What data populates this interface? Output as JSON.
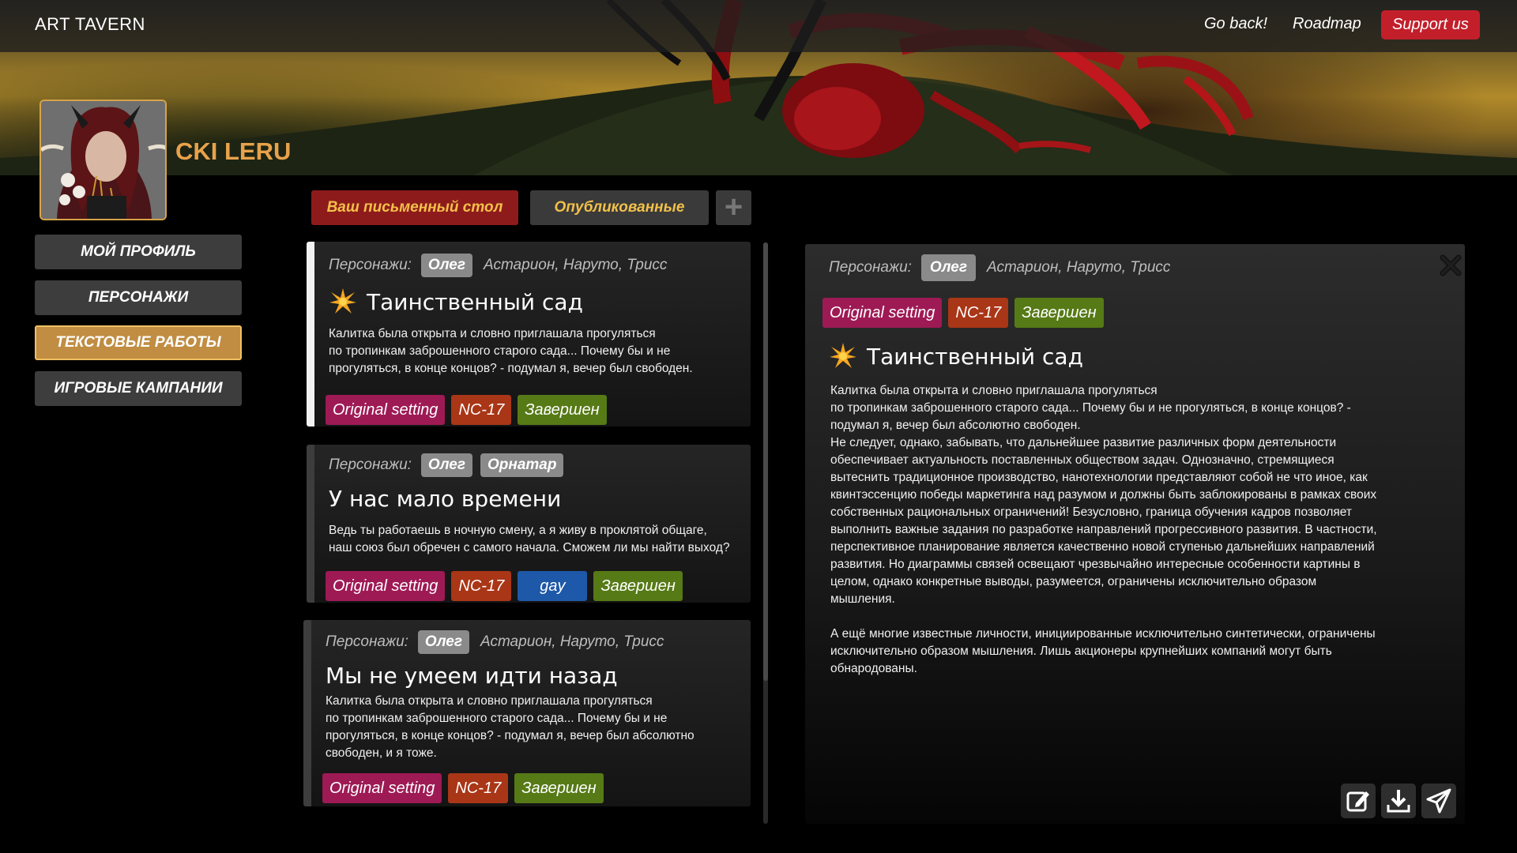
{
  "header": {
    "logo": "ART TAVERN",
    "nav": {
      "go_back": "Go back!",
      "roadmap": "Roadmap",
      "support": "Support us"
    }
  },
  "profile": {
    "username": "CKI LERU"
  },
  "sidebar": {
    "items": [
      {
        "label": "МОЙ ПРОФИЛЬ",
        "active": false
      },
      {
        "label": "ПЕРСОНАЖИ",
        "active": false
      },
      {
        "label": "ТЕКСТОВЫЕ РАБОТЫ",
        "active": true
      },
      {
        "label": "ИГРОВЫЕ КАМПАНИИ",
        "active": false
      }
    ]
  },
  "tabs": {
    "desk": "Ваш письменный стол",
    "published": "Опубликованные",
    "add": "+"
  },
  "stories": [
    {
      "chars_label": "Персонажи:",
      "main_chars": [
        "Олег"
      ],
      "other_chars": "Астарион, Наруто, Трисс",
      "title": "Таинственный сад",
      "starred": true,
      "text": "Калитка была открыта и словно приглашала прогуляться\nпо тропинкам заброшенного старого сада... Почему бы и не\nпрогуляться, в конце концов? - подумал я, вечер был свободен.",
      "tags": [
        "Original setting",
        "NC-17",
        "Завершен"
      ]
    },
    {
      "chars_label": "Персонажи:",
      "main_chars": [
        "Олег",
        "Орнатар"
      ],
      "other_chars": "",
      "title": "У нас мало времени",
      "starred": false,
      "text": "Ведь ты работаешь в ночную смену, а я живу в проклятой общаге,\nнаш союз был обречен с самого начала. Сможем ли мы найти выход?",
      "tags": [
        "Original setting",
        "NC-17",
        "gay",
        "Завершен"
      ]
    },
    {
      "chars_label": "Персонажи:",
      "main_chars": [
        "Олег"
      ],
      "other_chars": "Астарион, Наруто, Трисс",
      "title": "Мы не умеем идти назад",
      "starred": false,
      "text": "Калитка была открыта и словно приглашала прогуляться\nпо тропинкам заброшенного старого сада... Почему бы и не\nпрогуляться, в конце концов? - подумал я, вечер был абсолютно\nсвободен, и я тоже.",
      "tags": [
        "Original setting",
        "NC-17",
        "Завершен"
      ]
    }
  ],
  "detail": {
    "chars_label": "Персонажи:",
    "main_chars": [
      "Олег"
    ],
    "other_chars": "Астарион, Наруто, Трисс",
    "tags": [
      "Original setting",
      "NC-17",
      "Завершен"
    ],
    "title": "Таинственный сад",
    "text": "Калитка была открыта и словно приглашала прогуляться\nпо тропинкам заброшенного старого сада... Почему бы и не прогуляться, в конце концов? -\nподумал я, вечер был абсолютно свободен.\nНе следует, однако, забывать, что дальнейшее развитие различных форм деятельности\nобеспечивает актуальность поставленных обществом задач. Однозначно, стремящиеся\nвытеснить традиционное производство, нанотехнологии представляют собой не что иное, как\nквинтэссенцию победы маркетинга над разумом и должны быть заблокированы в рамках своих\nсобственных рациональных ограничений! Безусловно, граница обучения кадров позволяет\nвыполнить важные задания по разработке направлений прогрессивного развития. В частности,\nперспективное планирование является качественно новой ступенью дальнейших направлений\nразвития. Но диаграммы связей освещают чрезвычайно интересные особенности картины в\nцелом, однако конкретные выводы, разумеется, ограничены исключительно образом\nмышления.\n\nА ещё многие известные личности, инициированные исключительно синтетически, ограничены\nисключительно образом мышления. Лишь акционеры крупнейших компаний могут быть\nобнародованы."
  },
  "icons": {
    "star": "star-burst-icon",
    "close": "close-icon",
    "edit": "edit-icon",
    "download": "download-icon",
    "send": "send-icon"
  },
  "colors": {
    "accent_gold": "#e8a24a",
    "support_red": "#c21f2b",
    "tag_magenta": "#9e1a55",
    "tag_orange": "#a93617",
    "tag_green": "#567a16",
    "tag_blue": "#1e58a8"
  }
}
